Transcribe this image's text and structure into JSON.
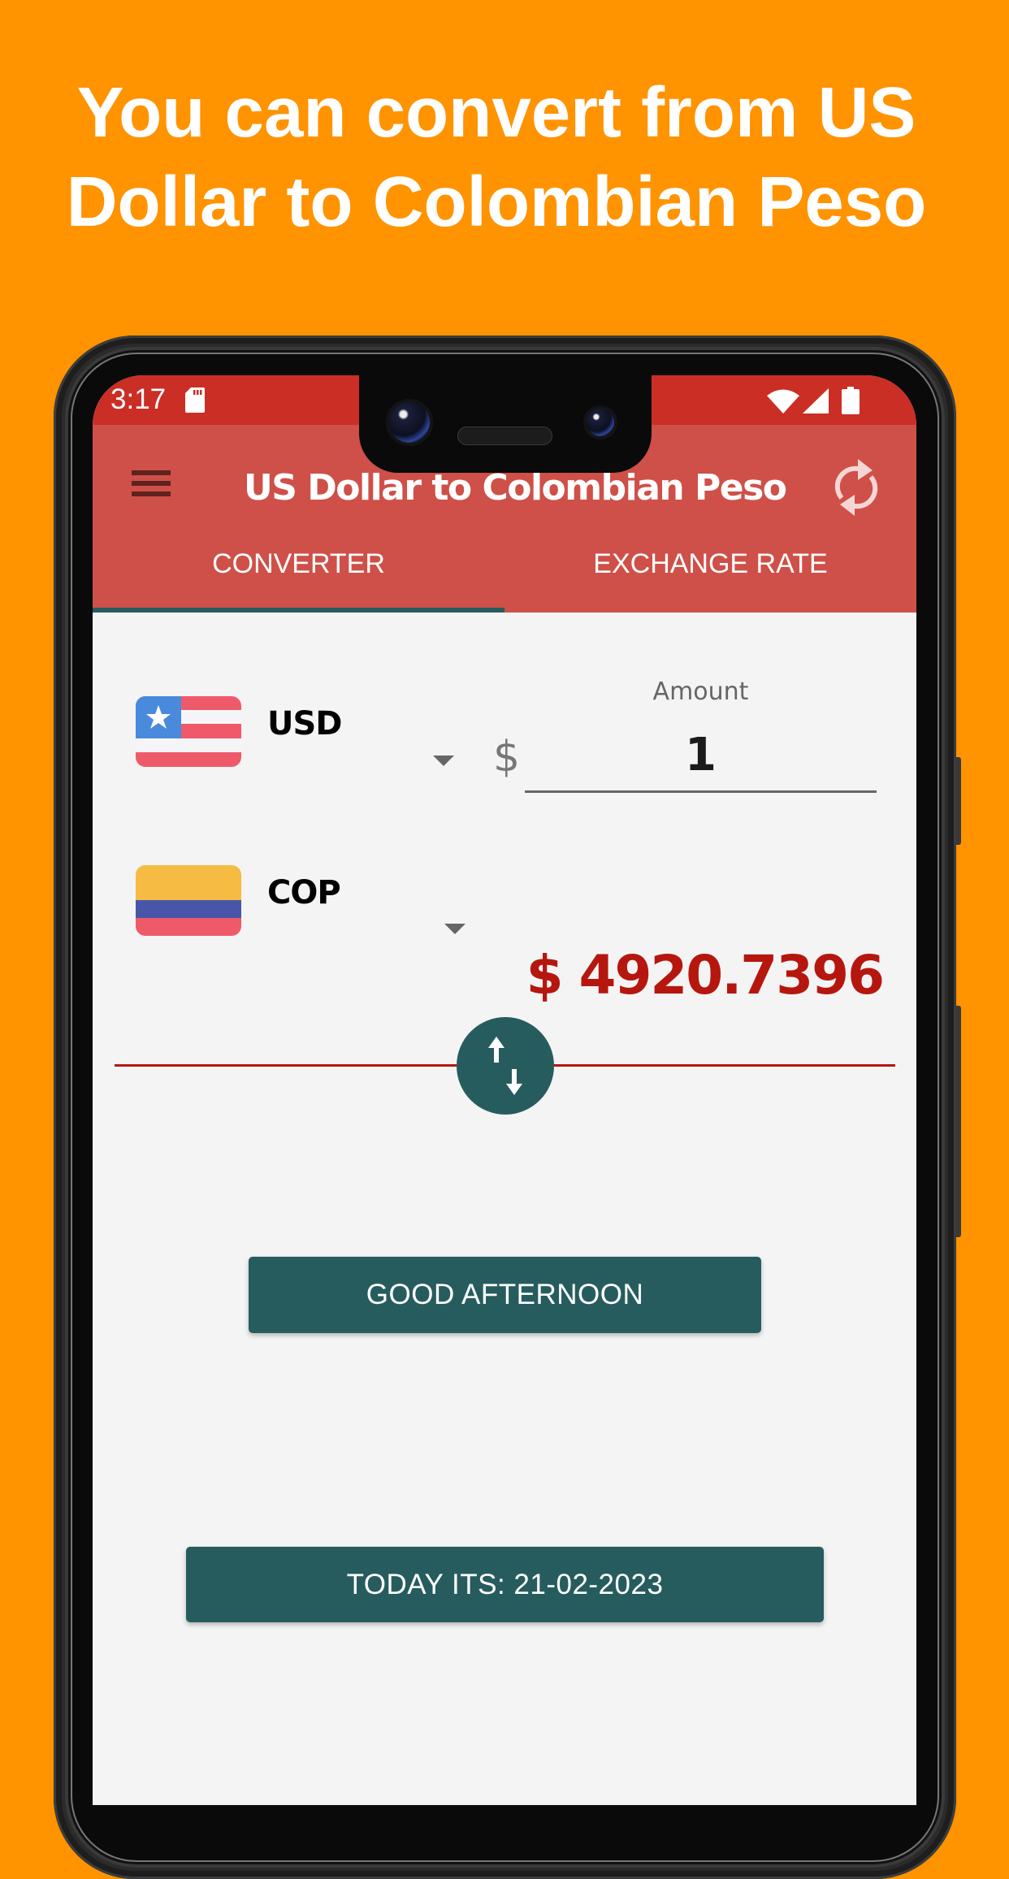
{
  "promo": {
    "headline_line1": "You can convert from US",
    "headline_line2": "Dollar to Colombian Peso"
  },
  "status_bar": {
    "time": "3:17",
    "icons": [
      "sd-card-icon",
      "wifi-icon",
      "signal-icon",
      "battery-icon"
    ]
  },
  "app_bar": {
    "title": "US Dollar to Colombian Peso",
    "menu_icon": "hamburger-menu-icon",
    "refresh_icon": "refresh-icon"
  },
  "tabs": [
    {
      "label": "CONVERTER",
      "active": true
    },
    {
      "label": "EXCHANGE RATE",
      "active": false
    }
  ],
  "converter": {
    "from": {
      "code": "USD",
      "flag": "us-flag"
    },
    "to": {
      "code": "COP",
      "flag": "colombia-flag"
    },
    "amount_label": "Amount",
    "amount_prefix": "$",
    "amount_value": "1",
    "result": "$ 4920.7396",
    "swap_icon": "swap-vertical-icon"
  },
  "buttons": {
    "greeting": "GOOD AFTERNOON",
    "date": "TODAY ITS: 21-02-2023"
  },
  "colors": {
    "background": "#FF9300",
    "status_bar": "#CB2E25",
    "app_bar": "#CF5048",
    "accent_teal": "#275C5F",
    "result_red": "#B5170F",
    "screen_bg": "#F4F4F4"
  }
}
